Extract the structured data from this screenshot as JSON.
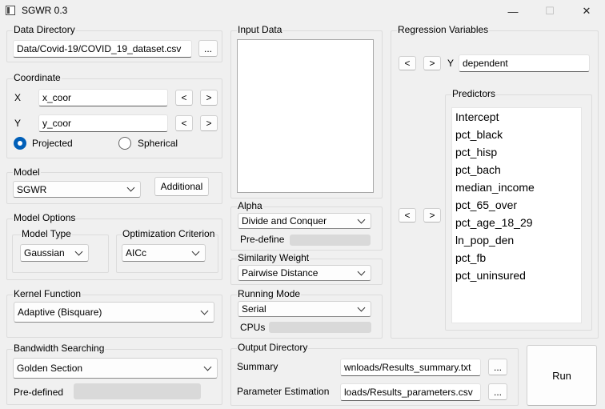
{
  "window": {
    "title": "SGWR 0.3",
    "minimize": "—",
    "maximize": "☐",
    "close": "✕"
  },
  "data_directory": {
    "title": "Data Directory",
    "path": "Data/Covid-19/COVID_19_dataset.csv",
    "browse": "..."
  },
  "coordinate": {
    "title": "Coordinate",
    "x_label": "X",
    "x_value": "x_coor",
    "y_label": "Y",
    "y_value": "y_coor",
    "prev": "<",
    "next": ">",
    "projected": "Projected",
    "spherical": "Spherical",
    "selected": "Projected"
  },
  "model": {
    "title": "Model",
    "value": "SGWR",
    "additional": "Additional"
  },
  "model_options": {
    "title": "Model Options",
    "model_type_title": "Model Type",
    "model_type": "Gaussian",
    "opt_title": "Optimization Criterion",
    "opt_value": "AICc"
  },
  "kernel": {
    "title": "Kernel Function",
    "value": "Adaptive (Bisquare)"
  },
  "bandwidth": {
    "title": "Bandwidth Searching",
    "value": "Golden Section",
    "predefined_label": "Pre-defined"
  },
  "input_data": {
    "title": "Input Data"
  },
  "alpha": {
    "title": "Alpha",
    "value": "Divide and Conquer",
    "predefine_label": "Pre-define"
  },
  "similarity": {
    "title": "Similarity Weight",
    "value": "Pairwise Distance"
  },
  "running": {
    "title": "Running Mode",
    "value": "Serial",
    "cpus_label": "CPUs"
  },
  "output": {
    "title": "Output Directory",
    "summary_label": "Summary",
    "summary_value": "wnloads/Results_summary.txt",
    "param_label": "Parameter Estimation",
    "param_value": "loads/Results_parameters.csv",
    "browse": "..."
  },
  "regression": {
    "title": "Regression Variables",
    "prev": "<",
    "next": ">",
    "y_label": "Y",
    "y_value": "dependent",
    "predictors_title": "Predictors",
    "predictors": [
      "Intercept",
      "pct_black",
      "pct_hisp",
      "pct_bach",
      "median_income",
      "pct_65_over",
      "pct_age_18_29",
      "ln_pop_den",
      "pct_fb",
      "pct_uninsured"
    ]
  },
  "run_label": "Run"
}
